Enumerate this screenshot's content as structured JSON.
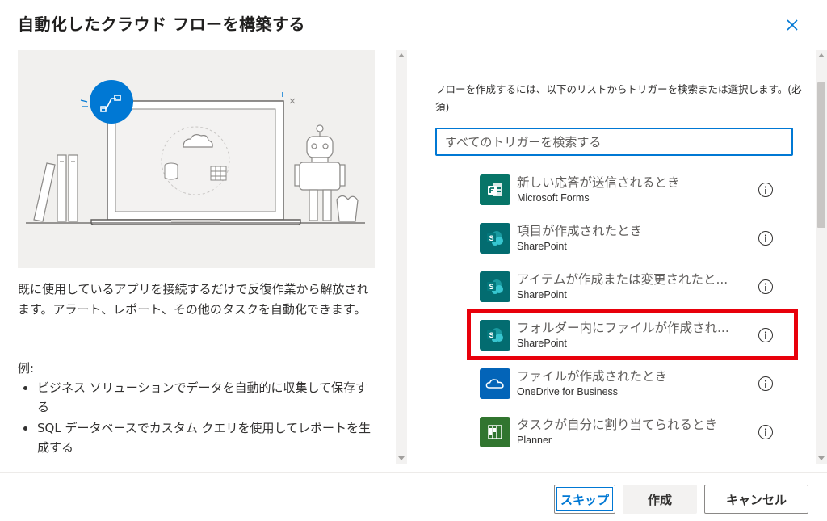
{
  "dialog": {
    "title": "自動化したクラウド フローを構築する",
    "description": "既に使用しているアプリを接続するだけで反復作業から解放されます。アラート、レポート、その他のタスクを自動化できます。",
    "example_label": "例:",
    "examples": [
      "ビジネス ソリューションでデータを自動的に収集して保存する",
      "SQL データベースでカスタム クエリを使用してレポートを生成する"
    ]
  },
  "trigger_panel": {
    "instruction": "フローを作成するには、以下のリストからトリガーを検索または選択します。(必須)",
    "search_placeholder": "すべてのトリガーを検索する",
    "triggers": [
      {
        "title": "新しい応答が送信されるとき",
        "connector": "Microsoft Forms",
        "icon": "forms-icon",
        "color": "#077568"
      },
      {
        "title": "項目が作成されたとき",
        "connector": "SharePoint",
        "icon": "sharepoint-icon",
        "color": "#036c70"
      },
      {
        "title": "アイテムが作成または変更されたと...",
        "connector": "SharePoint",
        "icon": "sharepoint-icon",
        "color": "#036c70"
      },
      {
        "title": "フォルダー内にファイルが作成され...",
        "connector": "SharePoint",
        "icon": "sharepoint-icon",
        "color": "#036c70"
      },
      {
        "title": "ファイルが作成されたとき",
        "connector": "OneDrive for Business",
        "icon": "onedrive-icon",
        "color": "#0364b8"
      },
      {
        "title": "タスクが自分に割り当てられるとき",
        "connector": "Planner",
        "icon": "planner-icon",
        "color": "#31752f"
      }
    ]
  },
  "footer": {
    "skip_label": "スキップ",
    "create_label": "作成",
    "cancel_label": "キャンセル"
  },
  "colors": {
    "accent": "#0078d4",
    "highlight": "#e8000b"
  }
}
